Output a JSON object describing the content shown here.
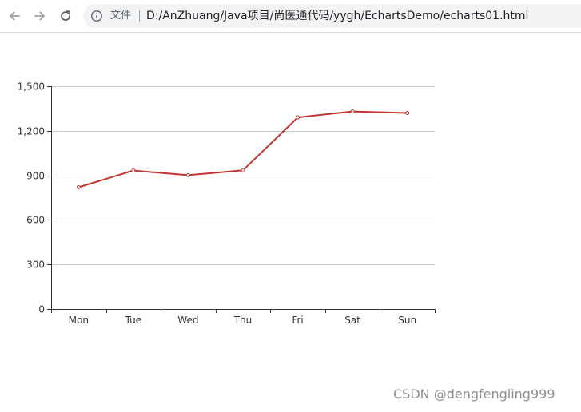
{
  "browser": {
    "scheme_label": "文件",
    "url": "D:/AnZhuang/Java项目/尚医通代码/yygh/EchartsDemo/echarts01.html"
  },
  "watermark": "CSDN @dengfengling999",
  "colors": {
    "series": "#c23531",
    "grid": "#cccccc",
    "axis": "#333333",
    "label": "#333333"
  },
  "icons": {
    "back": "back-arrow-icon",
    "forward": "forward-arrow-icon",
    "reload": "reload-icon",
    "info": "info-icon"
  },
  "chart_data": {
    "type": "line",
    "categories": [
      "Mon",
      "Tue",
      "Wed",
      "Thu",
      "Fri",
      "Sat",
      "Sun"
    ],
    "series": [
      {
        "values": [
          820,
          932,
          901,
          934,
          1290,
          1330,
          1320
        ]
      }
    ],
    "ylim": [
      0,
      1500
    ],
    "yticks": [
      "0",
      "300",
      "600",
      "900",
      "1,200",
      "1,500"
    ],
    "ytick_values": [
      0,
      300,
      600,
      900,
      1200,
      1500
    ],
    "grid": true,
    "markers": "hollow-circle"
  }
}
